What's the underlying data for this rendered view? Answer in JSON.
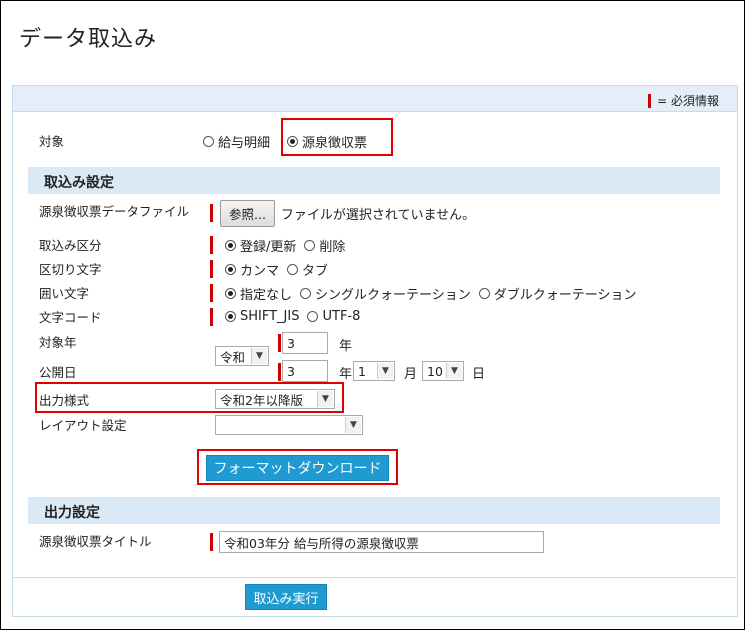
{
  "page": {
    "title": "データ取込み"
  },
  "legend": {
    "text": "= 必須情報"
  },
  "target": {
    "label": "対象",
    "options": [
      "給与明細",
      "源泉徴収票"
    ],
    "selected": "源泉徴収票"
  },
  "import_settings": {
    "section_title": "取込み設定",
    "file": {
      "label": "源泉徴収票データファイル",
      "button": "参照...",
      "status": "ファイルが選択されていません。"
    },
    "import_type": {
      "label": "取込み区分",
      "options": [
        "登録/更新",
        "削除"
      ],
      "selected": "登録/更新"
    },
    "delimiter": {
      "label": "区切り文字",
      "options": [
        "カンマ",
        "タブ"
      ],
      "selected": "カンマ"
    },
    "enclosure": {
      "label": "囲い文字",
      "options": [
        "指定なし",
        "シングルクォーテーション",
        "ダブルクォーテーション"
      ],
      "selected": "指定なし"
    },
    "encoding": {
      "label": "文字コード",
      "options": [
        "SHIFT_JIS",
        "UTF-8"
      ],
      "selected": "SHIFT_JIS"
    },
    "target_year": {
      "label": "対象年",
      "era": "令和",
      "value": "3",
      "unit": "年"
    },
    "publish_date": {
      "label": "公開日",
      "year": "3",
      "year_unit": "年",
      "month": "1",
      "month_unit": "月",
      "day": "10",
      "day_unit": "日"
    },
    "output_style": {
      "label": "出力様式",
      "value": "令和2年以降版"
    },
    "layout": {
      "label": "レイアウト設定",
      "value": ""
    },
    "download_button": "フォーマットダウンロード"
  },
  "output_settings": {
    "section_title": "出力設定",
    "title_field": {
      "label": "源泉徴収票タイトル",
      "value": "令和03年分 給与所得の源泉徴収票"
    }
  },
  "execute_button": "取込み実行",
  "colors": {
    "accent_blue": "#1f9bd1",
    "required_red": "#cc0000",
    "highlight_red": "#e00000",
    "section_bg": "#dbe9f6"
  }
}
